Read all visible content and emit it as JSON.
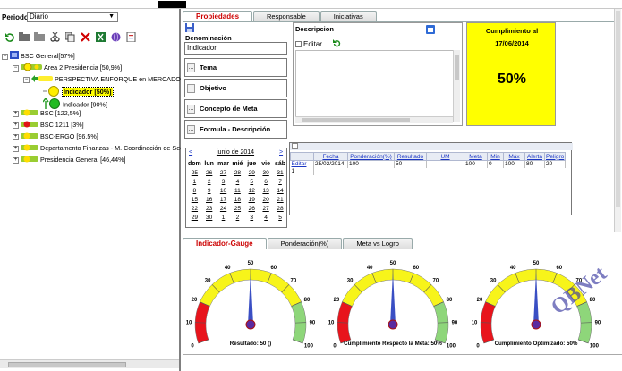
{
  "left": {
    "period_label": "Periodo:",
    "period_value": "Diario",
    "toolbar_icons": [
      "refresh-icon",
      "folder-icon",
      "folder-open-icon",
      "cut-icon",
      "copy-icon",
      "delete-icon",
      "excel-icon",
      "globe-icon",
      "report-icon"
    ],
    "tree": [
      {
        "label": "BSC General[57%]",
        "level": 0
      },
      {
        "label": "Area 2 Presidencia [50,9%]",
        "level": 1
      },
      {
        "label": "PERSPECTIVA ENFORQUE en MERCADOS Y CLIE",
        "level": 2
      },
      {
        "label": "Indicador [50%]",
        "level": 3,
        "selected": true
      },
      {
        "label": "Indicador [90%]",
        "level": 3
      },
      {
        "label": "BSC [122,5%]",
        "level": 1
      },
      {
        "label": "BSC 1211 [3%]",
        "level": 1
      },
      {
        "label": "BSC-ERGO [96,5%]",
        "level": 1
      },
      {
        "label": "Departamento Finanzas - M. Coordinación de Sectore",
        "level": 1
      },
      {
        "label": "Presidencia General [46,44%]",
        "level": 1
      }
    ]
  },
  "tabs_top": [
    "Propiedades",
    "Responsable",
    "Iniciativas"
  ],
  "props": {
    "denominacion_label": "Denominación",
    "denominacion_value": "Indicador",
    "tema_label": "Tema",
    "objetivo_label": "Objetivo",
    "concepto_label": "Concepto de Meta",
    "formula_label": "Formula - Descripción",
    "descripcion_label": "Descripcion",
    "editar_label": "Editar",
    "cumplimiento_title": "Cumplimiento al",
    "cumplimiento_date": "17/06/2014",
    "cumplimiento_value": "50%"
  },
  "calendar": {
    "prev": "<",
    "month": "junio de 2014",
    "next": ">",
    "days": [
      "dom",
      "lun",
      "mar",
      "mié",
      "jue",
      "vie",
      "sáb"
    ],
    "weeks": [
      [
        "25",
        "26",
        "27",
        "28",
        "29",
        "30",
        "31"
      ],
      [
        "1",
        "2",
        "3",
        "4",
        "5",
        "6",
        "7"
      ],
      [
        "8",
        "9",
        "10",
        "11",
        "12",
        "13",
        "14"
      ],
      [
        "15",
        "16",
        "17",
        "18",
        "19",
        "20",
        "21"
      ],
      [
        "22",
        "23",
        "24",
        "25",
        "26",
        "27",
        "28"
      ],
      [
        "29",
        "30",
        "1",
        "2",
        "3",
        "4",
        "5"
      ]
    ]
  },
  "grid": {
    "headers": [
      "",
      "Fecha",
      "Ponderación(%)",
      "Resultado",
      "UM",
      "Meta",
      "Min",
      "Máx",
      "Alerta",
      "Peligro"
    ],
    "rows": [
      [
        "Editar",
        "25/02/2014",
        "100",
        "50",
        "",
        "100",
        "0",
        "100",
        "80",
        "20"
      ]
    ],
    "pager": "1"
  },
  "tabs_bottom": [
    "Indicador-Gauge",
    "Ponderación(%)",
    "Meta vs Logro"
  ],
  "gauges": [
    {
      "caption": "Resultado: 50 ()",
      "value": 50
    },
    {
      "caption": "Cumplimiento Respecto la Meta: 50%",
      "value": 50
    },
    {
      "caption": "Cumplimiento Optimizado: 50%",
      "value": 50
    }
  ],
  "gauge_ticks": [
    "0",
    "10",
    "20",
    "30",
    "40",
    "50",
    "60",
    "70",
    "80",
    "90",
    "100"
  ],
  "watermark": "QBNet",
  "colors": {
    "selected_bg": "#ffff00",
    "tab_active": "#cc0000",
    "gauge_red": "#e8141c",
    "gauge_yellow": "#f7f41a",
    "gauge_green": "#8ed67a",
    "needle": "#3a4fc4"
  }
}
